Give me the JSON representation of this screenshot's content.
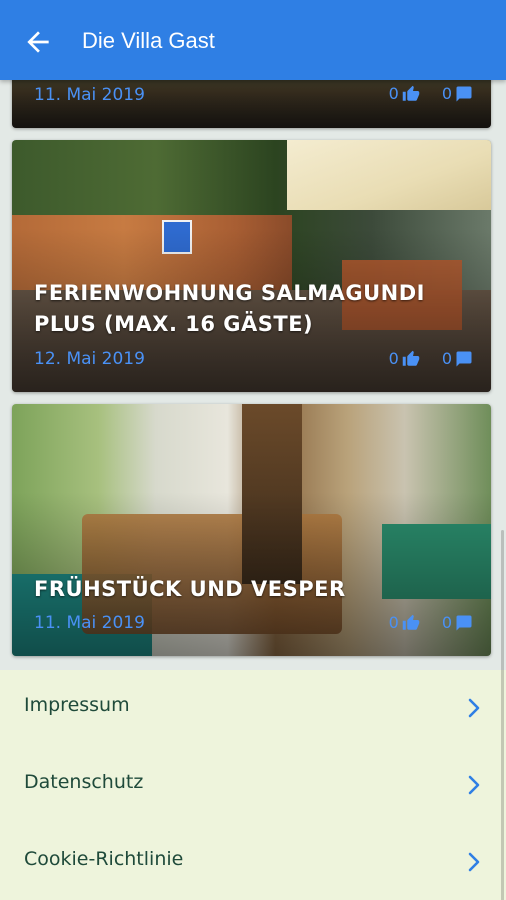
{
  "header": {
    "title": "Die Villa Gast",
    "back_icon": "arrow-back-icon"
  },
  "posts": [
    {
      "title": "",
      "date": "11. Mai 2019",
      "likes": "0",
      "comments": "0"
    },
    {
      "title": "Ferienwohnung Salmagundi Plus (max. 16 Gäste)",
      "date": "12. Mai 2019",
      "likes": "0",
      "comments": "0"
    },
    {
      "title": "Frühstück und Vesper",
      "date": "11. Mai 2019",
      "likes": "0",
      "comments": "0"
    }
  ],
  "menu": [
    {
      "label": "Impressum",
      "icon": "chevron-right-icon"
    },
    {
      "label": "Datenschutz",
      "icon": "chevron-right-icon"
    },
    {
      "label": "Cookie-Richtlinie",
      "icon": "chevron-right-icon"
    }
  ],
  "colors": {
    "appbar": "#2f7fe4",
    "accent": "#4a91f5",
    "menu_bg": "#eef4dc",
    "menu_text": "#1f4a3a"
  }
}
